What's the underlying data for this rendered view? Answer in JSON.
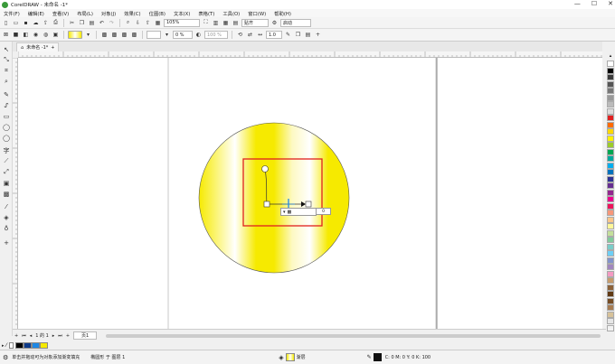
{
  "app": {
    "title": "CorelDRAW - 未命名 -1*",
    "window_controls": [
      "—",
      "☐",
      "✕"
    ]
  },
  "menu": [
    "文件(F)",
    "编辑(E)",
    "查看(V)",
    "布局(L)",
    "对象(J)",
    "效果(C)",
    "位图(B)",
    "文本(X)",
    "表格(T)",
    "工具(O)",
    "窗口(W)",
    "帮助(H)"
  ],
  "toolbar": {
    "zoom": "105%",
    "snap_label": "贴齐",
    "launch_label": "启动"
  },
  "property_bar": {
    "x_value": "0 %",
    "y_value": "100 %",
    "width_value": "1.0"
  },
  "document": {
    "tab_label": "未命名 -1*"
  },
  "pagebar": {
    "page_counter": "1 的 1",
    "page_tab": "页1"
  },
  "fill_control": {
    "value": "0"
  },
  "status": {
    "hint": "单击并拖动可为对象添加渐变填充",
    "object": "椭圆形 于 图层 1",
    "fill_label": "渐层",
    "outline": "C: 0 M: 0 Y: 0 K: 100"
  },
  "colors": {
    "accent_green": "#3a9a3a",
    "selection_red": "#e0201e",
    "gradient_yellow": "#f6ea00",
    "handle_blue": "#1e88e5"
  },
  "palette": [
    "#ffffff",
    "#000000",
    "#3a3a3a",
    "#555555",
    "#777777",
    "#999999",
    "#bbbbbb",
    "#dddddd",
    "#e02020",
    "#ff6a00",
    "#ffd800",
    "#fff200",
    "#9ccc2a",
    "#00a651",
    "#00a99d",
    "#00aeef",
    "#0072bc",
    "#2e3192",
    "#662d91",
    "#92278f",
    "#ec008c",
    "#ed145b",
    "#f7977a",
    "#fdc68a",
    "#fff799",
    "#c4df9b",
    "#82ca9c",
    "#7accc8",
    "#6dcff6",
    "#8393ca",
    "#a186be",
    "#f49ac2",
    "#c69c6d",
    "#8c6239",
    "#603913",
    "#754c24",
    "#a67c52",
    "#d7c29a",
    "#e6e6e6",
    "#f2f2f2"
  ],
  "doc_colors": [
    "#000000",
    "#0d3a8a",
    "#1e88e5",
    "#f6ea00"
  ]
}
